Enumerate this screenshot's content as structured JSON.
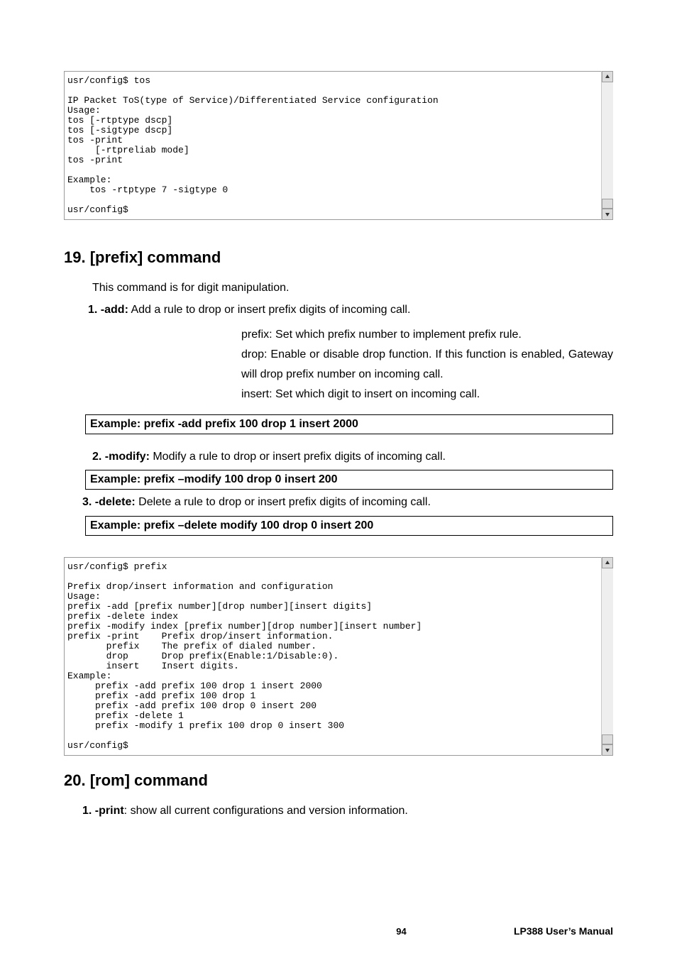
{
  "terminal1": {
    "text": "usr/config$ tos\n\nIP Packet ToS(type of Service)/Differentiated Service configuration\nUsage:\ntos [-rtptype dscp]\ntos [-sigtype dscp]\ntos -print\n     [-rtpreliab mode]\ntos -print\n\nExample:\n    tos -rtptype 7 -sigtype 0\n\nusr/config$"
  },
  "section19": {
    "heading": "19. [prefix] command",
    "intro": "This command is for digit manipulation.",
    "item1_label": "1. -add:",
    "item1_text": " Add a rule to drop or insert prefix digits of incoming call.",
    "sub1": "prefix: Set which prefix number to implement prefix rule.",
    "sub2": "drop: Enable or disable drop function. If this function is enabled, Gateway will drop prefix number on incoming call.",
    "sub3": "insert: Set which digit to insert on incoming call.",
    "example1": "Example: prefix -add prefix 100 drop 1 insert 2000",
    "item2_label": "2. -modify:",
    "item2_text": " Modify a rule to drop or insert prefix digits of incoming call.",
    "example2": "Example: prefix –modify 100 drop 0 insert 200",
    "item3_label": "3. -delete:",
    "item3_text": " Delete a rule to drop or insert prefix digits of incoming call.",
    "example3": "Example: prefix –delete modify 100 drop 0 insert 200"
  },
  "terminal2": {
    "text": "usr/config$ prefix\n\nPrefix drop/insert information and configuration\nUsage:\nprefix -add [prefix number][drop number][insert digits]\nprefix -delete index\nprefix -modify index [prefix number][drop number][insert number]\nprefix -print    Prefix drop/insert information.\n       prefix    The prefix of dialed number.\n       drop      Drop prefix(Enable:1/Disable:0).\n       insert    Insert digits.\nExample:\n     prefix -add prefix 100 drop 1 insert 2000\n     prefix -add prefix 100 drop 1\n     prefix -add prefix 100 drop 0 insert 200\n     prefix -delete 1\n     prefix -modify 1 prefix 100 drop 0 insert 300\n\nusr/config$"
  },
  "section20": {
    "heading": "20. [rom] command",
    "item1_label": "1. -print",
    "item1_text": ": show all current configurations and version information."
  },
  "footer": {
    "page": "94",
    "manual": "LP388  User’s  Manual"
  }
}
